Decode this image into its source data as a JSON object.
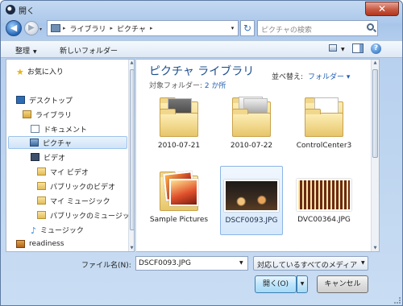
{
  "window": {
    "title": "開く",
    "close_glyph": "✕"
  },
  "address": {
    "back_glyph": "◀",
    "forward_glyph": "▶",
    "crumbs": [
      "ライブラリ",
      "ピクチャ"
    ],
    "separator": "▸",
    "dropdown_glyph": "▾",
    "refresh_glyph": "↻",
    "search_placeholder": "ピクチャの検索"
  },
  "toolbar": {
    "organize": "整理",
    "new_folder": "新しいフォルダー",
    "dd": "▼",
    "help": "?"
  },
  "nav": {
    "items": [
      {
        "label": "お気に入り",
        "icon": "star-icon"
      },
      {
        "label": "デスクトップ",
        "icon": "desktop-icon"
      },
      {
        "label": "ライブラリ",
        "icon": "library-icon"
      },
      {
        "label": "ドキュメント",
        "icon": "document-icon"
      },
      {
        "label": "ピクチャ",
        "icon": "picture-icon",
        "selected": true
      },
      {
        "label": "ビデオ",
        "icon": "video-icon"
      },
      {
        "label": "マイ ビデオ",
        "icon": "folder-icon"
      },
      {
        "label": "パブリックのビデオ",
        "icon": "folder-icon"
      },
      {
        "label": "マイ ミュージック",
        "icon": "folder-icon"
      },
      {
        "label": "パブリックのミュージック",
        "icon": "folder-icon"
      },
      {
        "label": "ミュージック",
        "icon": "music-icon"
      },
      {
        "label": "readiness",
        "icon": "home-icon"
      }
    ]
  },
  "content": {
    "title": "ピクチャ ライブラリ",
    "subtitle_prefix": "対象フォルダー:",
    "subtitle_link": "2 か所",
    "arrange_label": "並べ替え:",
    "arrange_value": "フォルダー ▾",
    "items": [
      {
        "label": "2010-07-21",
        "kind": "folder"
      },
      {
        "label": "2010-07-22",
        "kind": "folder"
      },
      {
        "label": "ControlCenter3",
        "kind": "folder"
      },
      {
        "label": "Sample Pictures",
        "kind": "folder"
      },
      {
        "label": "DSCF0093.JPG",
        "kind": "image",
        "selected": true
      },
      {
        "label": "DVC00364.JPG",
        "kind": "image"
      }
    ]
  },
  "footer": {
    "filename_label": "ファイル名(N):",
    "filename_value": "DSCF0093.JPG",
    "filter_value": "対応しているすべてのメディア",
    "open_label": "開く(O)",
    "cancel_label": "キャンセル"
  },
  "colors": {
    "accent": "#1e4e8c",
    "link": "#1f5fb1",
    "close": "#c85a42"
  }
}
